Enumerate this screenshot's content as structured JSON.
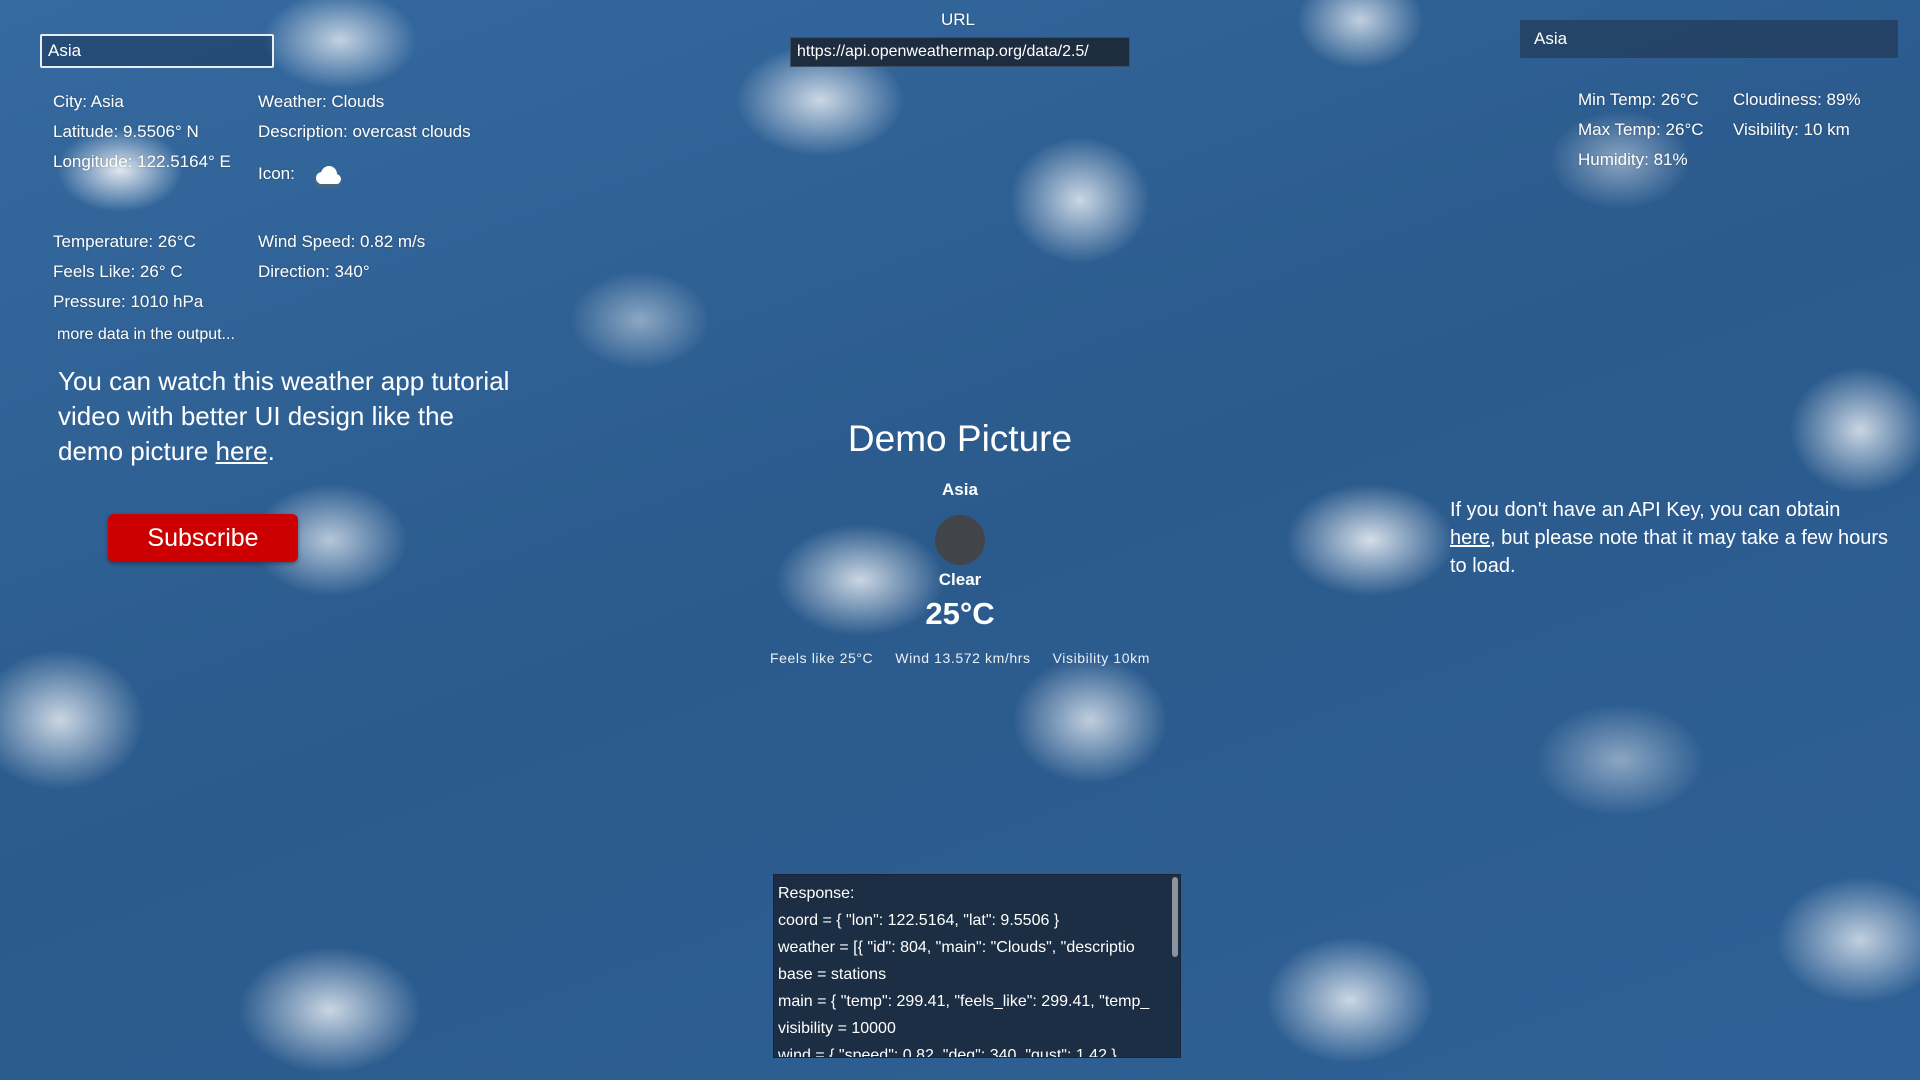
{
  "search_left": {
    "value": "Asia"
  },
  "search_right": {
    "value": "Asia"
  },
  "url": {
    "label": "URL",
    "value": "https://api.openweathermap.org/data/2.5/"
  },
  "details": {
    "city": "City: Asia",
    "latitude": "Latitude: 9.5506° N",
    "longitude": "Longitude: 122.5164° E",
    "weather": "Weather: Clouds",
    "description": "Description: overcast clouds",
    "icon_label": "Icon:",
    "icon_name": "cloud-icon",
    "temperature": "Temperature: 26°C",
    "feels_like": "Feels Like: 26° C",
    "pressure": "Pressure: 1010 hPa",
    "wind_speed": "Wind Speed: 0.82 m/s",
    "direction": "Direction: 340°",
    "more": "more data in the output..."
  },
  "extra": {
    "min_temp": "Min Temp: 26°C",
    "max_temp": "Max Temp: 26°C",
    "humidity": "Humidity: 81%",
    "cloudiness": "Cloudiness: 89%",
    "visibility": "Visibility: 10 km"
  },
  "tutorial": {
    "text": "You can watch this weather app tutorial video with better UI design like the demo picture ",
    "link": "here",
    "end": "."
  },
  "subscribe_label": "Subscribe",
  "demo": {
    "title": "Demo Picture",
    "city": "Asia",
    "condition": "Clear",
    "temp": "25°C",
    "feels": "Feels like 25°C",
    "wind": "Wind 13.572 km/hrs",
    "visibility": "Visibility 10km"
  },
  "apikey": {
    "text": "If you don't have an API Key, you can obtain ",
    "link": "here",
    "end": ", but please note that it may take a few hours to load."
  },
  "response": {
    "label": "Response:",
    "lines": [
      "coord = { \"lon\": 122.5164, \"lat\": 9.5506 }",
      "weather = [{ \"id\": 804, \"main\": \"Clouds\", \"descriptio",
      "base = stations",
      "main = { \"temp\": 299.41, \"feels_like\": 299.41, \"temp_",
      "visibility = 10000",
      "wind = { \"speed\": 0.82, \"deg\": 340, \"gust\": 1.42 }"
    ]
  },
  "colors": {
    "subscribe": "#cc0000",
    "sky": "#2f5f93"
  }
}
